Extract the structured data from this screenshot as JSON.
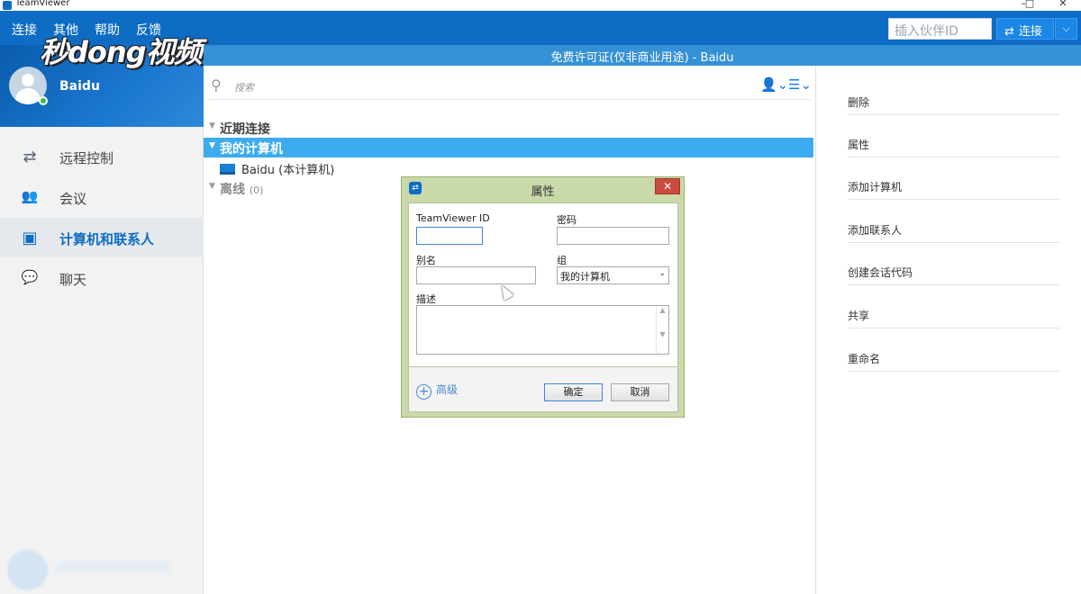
{
  "window": {
    "title": "TeamViewer",
    "controls": [
      "–",
      "□",
      "✕"
    ]
  },
  "menu": [
    "连接",
    "其他",
    "帮助",
    "反馈"
  ],
  "watermark": "秒dong视频",
  "partner_id": {
    "placeholder": "插入伙伴ID"
  },
  "connect": {
    "label": "连接",
    "dropdown": "⌵"
  },
  "profile": {
    "name": "Baidu"
  },
  "license_bar": "免费许可证(仅非商业用途) - Baidu",
  "nav": [
    {
      "label": "远程控制",
      "icon": "⇄"
    },
    {
      "label": "会议",
      "icon": "👥"
    },
    {
      "label": "计算机和联系人",
      "icon": "▣"
    },
    {
      "label": "聊天",
      "icon": "💬"
    }
  ],
  "search": {
    "placeholder": "搜索"
  },
  "groups": {
    "recent": "近期连接",
    "my_computers": "我的计算机",
    "computer_item": "Baidu (本计算机)",
    "offline": "离线",
    "offline_count": "(0)"
  },
  "actions": [
    "删除",
    "属性",
    "添加计算机",
    "添加联系人",
    "创建会话代码",
    "共享",
    "重命名"
  ],
  "dialog": {
    "title": "属性",
    "close": "✕",
    "teamviewer_id_label": "TeamViewer ID",
    "password_label": "密码",
    "alias_label": "别名",
    "group_label": "组",
    "group_value": "我的计算机",
    "description_label": "描述",
    "advanced": "高级",
    "ok": "确定",
    "cancel": "取消"
  },
  "colors": {
    "brand": "#0e6cc4",
    "selection": "#3dabef",
    "license_bar": "#3591d5"
  }
}
